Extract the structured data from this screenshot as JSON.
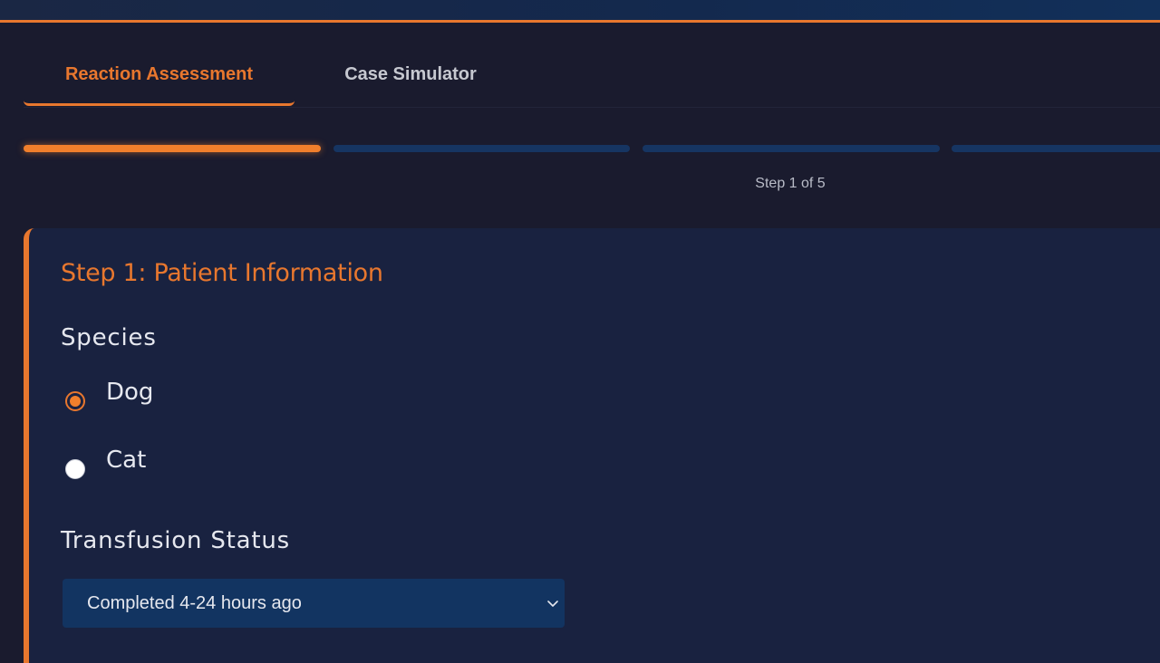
{
  "tabs": [
    {
      "label": "Reaction Assessment",
      "active": true
    },
    {
      "label": "Case Simulator",
      "active": false
    }
  ],
  "progress": {
    "current_step": 1,
    "total_steps": 5,
    "label": "Step 1 of 5"
  },
  "card": {
    "title": "Step 1: Patient Information",
    "species": {
      "label": "Species",
      "options": [
        {
          "label": "Dog",
          "checked": true
        },
        {
          "label": "Cat",
          "checked": false
        }
      ]
    },
    "transfusion_status": {
      "label": "Transfusion Status",
      "selected": "Completed 4-24 hours ago"
    }
  },
  "icons": {
    "dropdown": "chevron-down-icon",
    "radio_checked": "radio-checked-icon",
    "radio_unchecked": "radio-unchecked-icon"
  },
  "colors": {
    "accent": "#e8772e",
    "background": "#1a1b2e",
    "card": "#192240",
    "progress_inactive": "#163562",
    "select_background": "#123461"
  }
}
